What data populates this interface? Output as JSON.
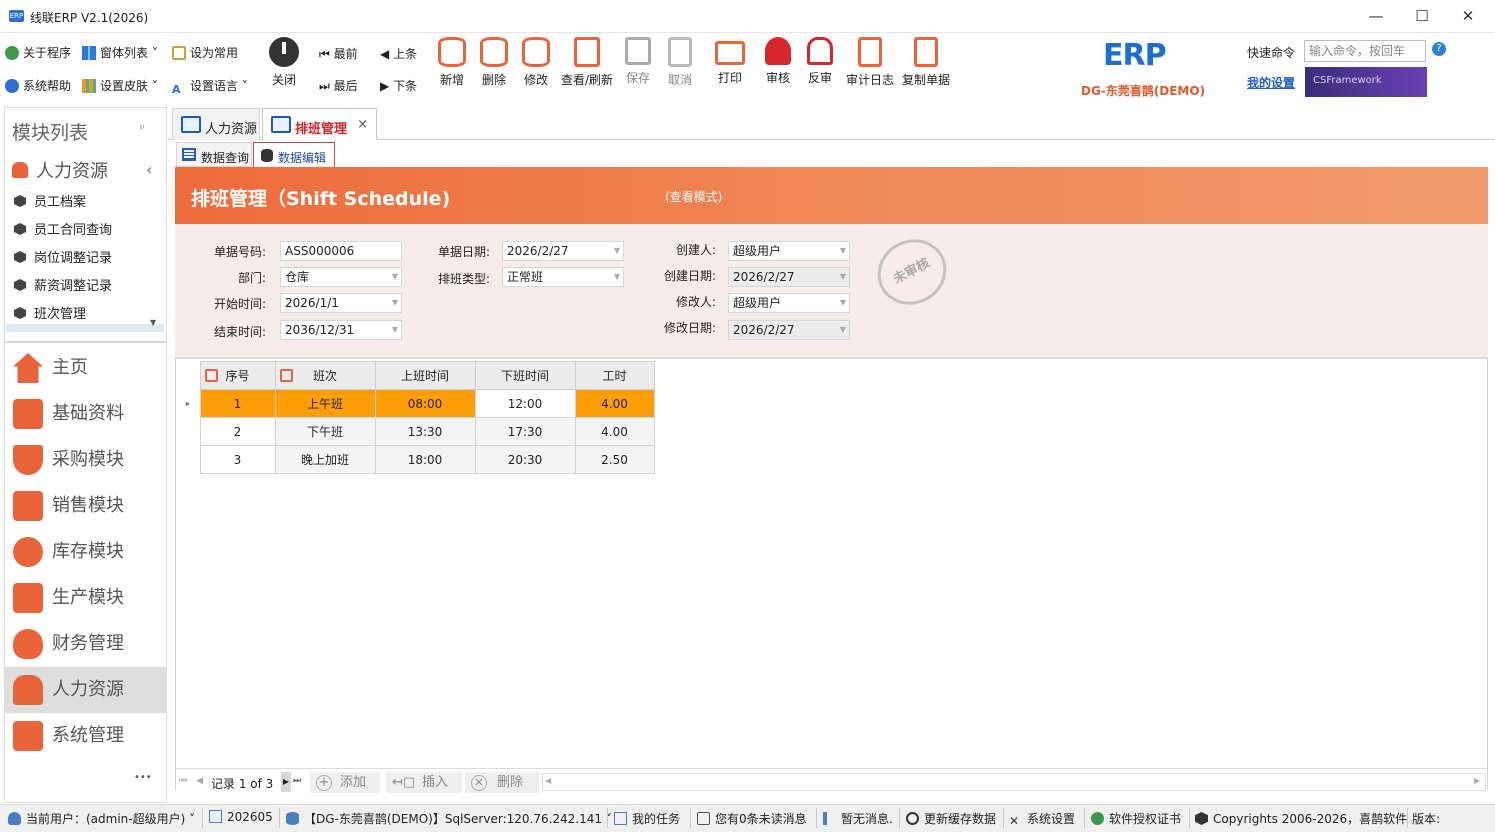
{
  "window": {
    "title": "线联ERP V2.1(2026)",
    "logo_text": "ERP",
    "min": "—",
    "max": "☐",
    "close": "✕"
  },
  "toolbar": {
    "about": "关于程序",
    "window_list": "窗体列表",
    "set_common": "设为常用",
    "help": "系统帮助",
    "skin": "设置皮肤",
    "language": "设置语言",
    "close": "关闭",
    "first": "最前",
    "prev": "上条",
    "last": "最后",
    "next": "下条",
    "new": "新增",
    "delete": "删除",
    "edit": "修改",
    "view_refresh": "查看/刷新",
    "save": "保存",
    "cancel": "取消",
    "print": "打印",
    "approve": "审核",
    "unapprove": "反审",
    "audit_log": "审计日志",
    "copy_doc": "复制单据"
  },
  "brand": {
    "subtitle": "DG-东莞喜鹊(DEMO)",
    "logo": "ERP",
    "csframework": "CSFramework"
  },
  "quick": {
    "label": "快速命令",
    "placeholder": "输入命令，按回车",
    "help": "?",
    "my_settings": "我的设置"
  },
  "sidebar": {
    "header": "模块列表",
    "pin": "ᵖ",
    "group": "人力资源",
    "group_arrow": "‹",
    "sub_items": [
      "员工档案",
      "员工合同查询",
      "岗位调整记录",
      "薪资调整记录",
      "班次管理"
    ],
    "modules": [
      "主页",
      "基础资料",
      "采购模块",
      "销售模块",
      "库存模块",
      "生产模块",
      "财务管理",
      "人力资源",
      "系统管理"
    ],
    "more": "•••"
  },
  "tabs": {
    "tab1": "人力资源",
    "tab2": "排班管理",
    "tab2_close": "×",
    "sub1": "数据查询",
    "sub2": "数据编辑"
  },
  "banner": {
    "title": "排班管理（Shift Schedule)",
    "mode": "(查看模式)"
  },
  "form": {
    "doc_no_label": "单据号码:",
    "doc_no": "ASS000006",
    "dept_label": "部门:",
    "dept": "仓库",
    "start_label": "开始时间:",
    "start": "2026/1/1",
    "end_label": "结束时间:",
    "end": "2036/12/31",
    "doc_date_label": "单据日期:",
    "doc_date": "2026/2/27",
    "shift_type_label": "排班类型:",
    "shift_type": "正常班",
    "creator_label": "创建人:",
    "creator": "超级用户",
    "created_label": "创建日期:",
    "created": "2026/2/27",
    "modifier_label": "修改人:",
    "modifier": "超级用户",
    "modified_label": "修改日期:",
    "modified": "2026/2/27",
    "stamp": "未审核"
  },
  "grid": {
    "headers": [
      "序号",
      "班次",
      "上班时间",
      "下班时间",
      "工时"
    ],
    "rows": [
      [
        "1",
        "上午班",
        "08:00",
        "12:00",
        "4.00"
      ],
      [
        "2",
        "下午班",
        "13:30",
        "17:30",
        "4.00"
      ],
      [
        "3",
        "晚上加班",
        "18:00",
        "20:30",
        "2.50"
      ]
    ]
  },
  "nav": {
    "record": "记录 1 of 3",
    "add": "添加",
    "insert": "插入",
    "delete": "删除"
  },
  "status": {
    "user": "当前用户：(admin-超级用户)",
    "period": "202605",
    "db": "【DG-东莞喜鹊(DEMO)】SqlServer:120.76.242.141",
    "tasks": "我的任务",
    "unread": "您有0条未读消息",
    "msg": "暂无消息.",
    "cache": "更新缓存数据",
    "settings": "系统设置",
    "license": "软件授权证书",
    "copyright": "Copyrights 2006-2026，喜鹊软件",
    "version": "版本:"
  }
}
